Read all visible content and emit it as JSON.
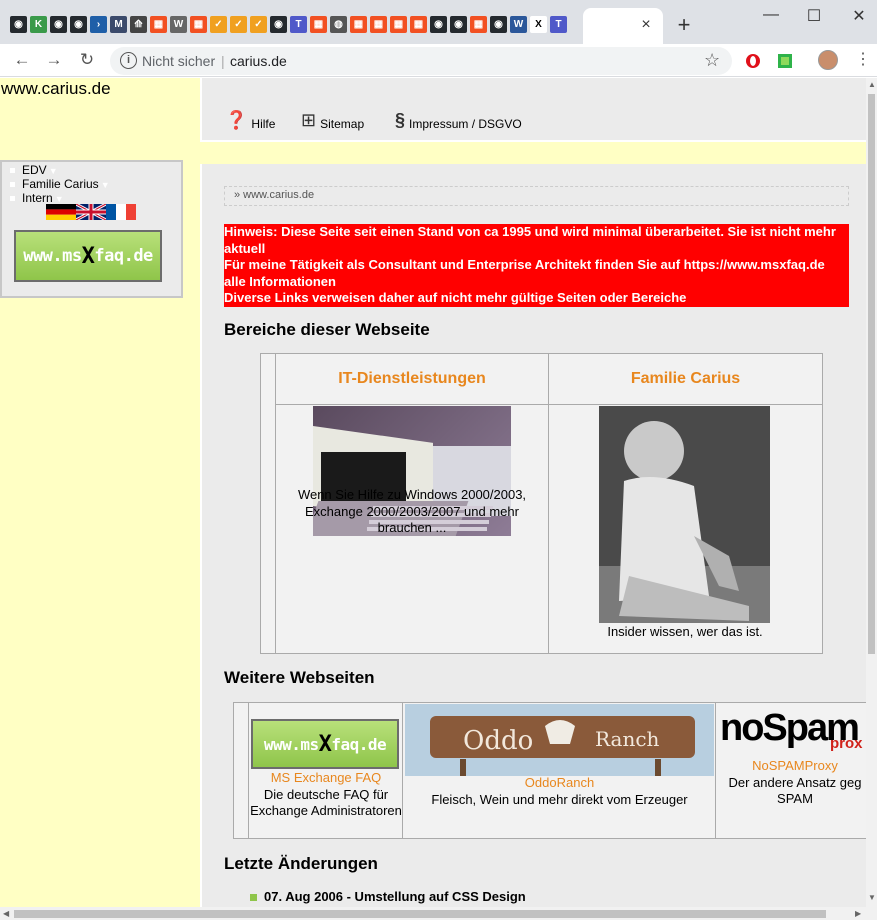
{
  "browser": {
    "tab_close": "×",
    "new_tab": "+",
    "minimize": "—",
    "maximize": "☐",
    "close": "✕",
    "security": "Nicht sicher",
    "separator": "|",
    "url": "carius.de",
    "tab_icons": [
      {
        "name": "github-icon",
        "color": "#24292e",
        "glyph": "◉"
      },
      {
        "name": "app-icon",
        "color": "#3a9a4a",
        "glyph": "K"
      },
      {
        "name": "github-icon",
        "color": "#24292e",
        "glyph": "◉"
      },
      {
        "name": "github-icon",
        "color": "#24292e",
        "glyph": "◉"
      },
      {
        "name": "powershell-icon",
        "color": "#1f5fa8",
        "glyph": "›"
      },
      {
        "name": "m-icon",
        "color": "#3b4a6b",
        "glyph": "M"
      },
      {
        "name": "arrow-icon",
        "color": "#444",
        "glyph": "⟰"
      },
      {
        "name": "microsoft-icon",
        "color": "#f25022",
        "glyph": "▦"
      },
      {
        "name": "wikipedia-icon",
        "color": "#666",
        "glyph": "W"
      },
      {
        "name": "microsoft-icon",
        "color": "#f25022",
        "glyph": "▦"
      },
      {
        "name": "check-icon",
        "color": "#f0a020",
        "glyph": "✓"
      },
      {
        "name": "check-icon",
        "color": "#f0a020",
        "glyph": "✓"
      },
      {
        "name": "check-icon",
        "color": "#f0a020",
        "glyph": "✓"
      },
      {
        "name": "github-icon",
        "color": "#24292e",
        "glyph": "◉"
      },
      {
        "name": "teams-icon",
        "color": "#5059c9",
        "glyph": "T"
      },
      {
        "name": "microsoft-icon",
        "color": "#f25022",
        "glyph": "▦"
      },
      {
        "name": "globe-icon",
        "color": "#555",
        "glyph": "◍"
      },
      {
        "name": "microsoft-icon",
        "color": "#f25022",
        "glyph": "▦"
      },
      {
        "name": "microsoft-icon",
        "color": "#f25022",
        "glyph": "▦"
      },
      {
        "name": "microsoft-icon",
        "color": "#f25022",
        "glyph": "▦"
      },
      {
        "name": "microsoft-icon",
        "color": "#f25022",
        "glyph": "▦"
      },
      {
        "name": "github-icon",
        "color": "#24292e",
        "glyph": "◉"
      },
      {
        "name": "github-icon",
        "color": "#24292e",
        "glyph": "◉"
      },
      {
        "name": "microsoft-icon",
        "color": "#f25022",
        "glyph": "▦"
      },
      {
        "name": "github-icon",
        "color": "#24292e",
        "glyph": "◉"
      },
      {
        "name": "word-icon",
        "color": "#2b579a",
        "glyph": "W"
      },
      {
        "name": "x-icon",
        "color": "#fff",
        "glyph": "X"
      },
      {
        "name": "teams-icon",
        "color": "#5059c9",
        "glyph": "T"
      }
    ]
  },
  "site": {
    "title": "www.carius.de",
    "topnav": [
      {
        "icon": "?",
        "label": "Hilfe"
      },
      {
        "icon": "⊞",
        "label": "Sitemap"
      },
      {
        "icon": "§",
        "label": "Impressum / DSGVO"
      }
    ],
    "menu": [
      "EDV",
      "Familie Carius",
      "Intern"
    ],
    "msxfaq_logo": {
      "pre": "www.ms",
      "x": "X",
      "post": "faq.de"
    },
    "breadcrumb": "» www.carius.de",
    "notice": [
      "Hinweis: Diese Seite seit einen Stand von ca 1995 und wird minimal überarbeitet. Sie ist nicht mehr aktuell",
      "Für meine Tätigkeit als Consultant und Enterprise Architekt finden Sie auf https://www.msxfaq.de alle Informationen",
      "Diverse Links verweisen daher auf nicht mehr gültige Seiten oder Bereiche"
    ],
    "areas_heading": "Bereiche dieser Webseite",
    "areas": [
      {
        "title": "IT-Dienstleistungen",
        "caption": "Wenn Sie Hilfe zu Windows 2000/2003, Exchange 2000/2003/2007 und mehr brauchen ..."
      },
      {
        "title": "Familie Carius",
        "caption": "Insider wissen, wer das ist."
      }
    ],
    "sites_heading": "Weitere Webseiten",
    "sites": [
      {
        "link": "MS Exchange FAQ",
        "desc": "Die deutsche FAQ für Exchange Administratoren"
      },
      {
        "link": "OddoRanch",
        "desc": "Fleisch, Wein und mehr direkt vom Erzeuger",
        "sign_left": "Oddo",
        "sign_right": "Ranch"
      },
      {
        "link": "NoSPAMProxy",
        "desc": "Der andere Ansatz geg SPAM",
        "logo": "noSpam",
        "logo_sub": "prox"
      }
    ],
    "changes_heading": "Letzte Änderungen",
    "changes": [
      "07. Aug 2006 - Umstellung auf CSS Design"
    ]
  }
}
